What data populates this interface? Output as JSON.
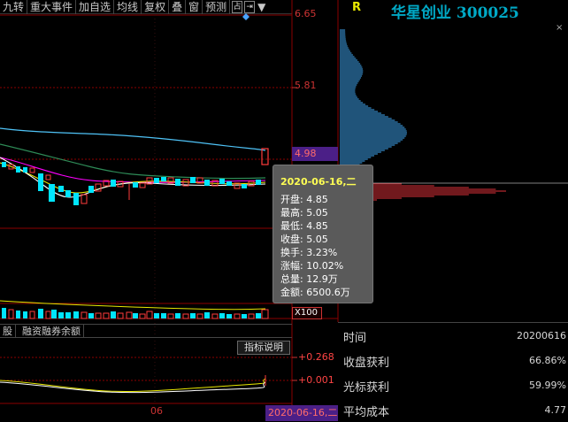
{
  "toolbar": {
    "items": [
      "九转",
      "重大事件",
      "加自选",
      "均线",
      "复权",
      "叠",
      "窗",
      "预测"
    ],
    "icon_a": "占",
    "icon_b": "▼"
  },
  "price_axis": {
    "labels": [
      "6.65",
      "5.81",
      "4.98"
    ],
    "current": "4.98"
  },
  "title": {
    "r_mark": "R",
    "stock": "华星创业 300025",
    "close_mark": "×"
  },
  "tooltip": {
    "date": "2020-06-16,二",
    "rows": [
      "开盘: 4.85",
      "最高: 5.05",
      "最低: 4.85",
      "收盘: 5.05",
      "换手: 3.23%",
      "涨幅: 10.02%",
      "总量: 12.9万",
      "金额: 6500.6万"
    ]
  },
  "volume_scale": "X100",
  "tabs": [
    "股",
    "融资融券余额"
  ],
  "indicator_button": "指标说明",
  "lower_axis": [
    "+0.268",
    "+0.001"
  ],
  "x_axis": {
    "tick": "06",
    "current_date": "2020-06-16,二"
  },
  "info_panel": [
    {
      "label": "时间",
      "value": "20200616"
    },
    {
      "label": "收盘获利",
      "value": "66.86%"
    },
    {
      "label": "光标获利",
      "value": "59.99%"
    },
    {
      "label": "平均成本",
      "value": "4.77"
    }
  ],
  "colors": {
    "up": "#ff3b3b",
    "down": "#00e5ff",
    "ma_short": "#ffffff",
    "ma_mid": "#ffff00",
    "ma_long": "#ff00ff",
    "ma_longer": "#00ff00",
    "ma_longest": "#4fc3f7"
  }
}
